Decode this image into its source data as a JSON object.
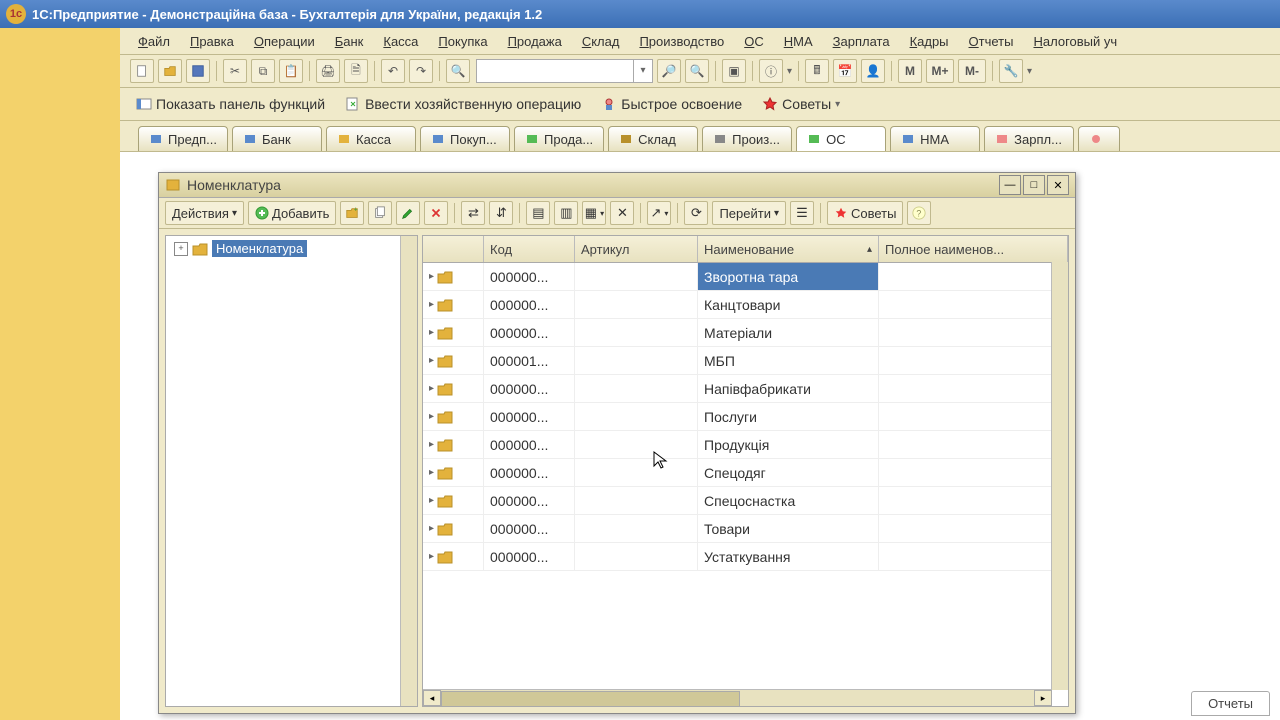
{
  "app": {
    "title": "1С:Предприятие - Демонстраційна база - Бухгалтерія для України, редакція 1.2"
  },
  "menu": [
    "Файл",
    "Правка",
    "Операции",
    "Банк",
    "Касса",
    "Покупка",
    "Продажа",
    "Склад",
    "Производство",
    "ОС",
    "НМА",
    "Зарплата",
    "Кадры",
    "Отчеты",
    "Налоговый уч"
  ],
  "funcbar": {
    "show_panel": "Показать панель функций",
    "enter_op": "Ввести хозяйственную операцию",
    "quick": "Быстрое освоение",
    "tips": "Советы"
  },
  "tabs": [
    "Предп...",
    "Банк",
    "Касса",
    "Покуп...",
    "Прода...",
    "Склад",
    "Произ...",
    "ОС",
    "НМА",
    "Зарпл..."
  ],
  "active_tab_index": 7,
  "window": {
    "title": "Номенклатура",
    "actions_label": "Действия",
    "add_label": "Добавить",
    "goto_label": "Перейти",
    "tips_label": "Советы",
    "tree_root": "Номенклатура",
    "columns": {
      "c1": "",
      "c2": "Код",
      "c3": "Артикул",
      "c4": "Наименование",
      "c5": "Полное наименов..."
    },
    "col_widths": {
      "c1": 48,
      "c2": 78,
      "c3": 110,
      "c4": 168,
      "c5": 176
    },
    "rows": [
      {
        "code": "000000...",
        "art": "",
        "name": "Зворотна тара",
        "full": ""
      },
      {
        "code": "000000...",
        "art": "",
        "name": "Канцтовари",
        "full": ""
      },
      {
        "code": "000000...",
        "art": "",
        "name": "Матеріали",
        "full": ""
      },
      {
        "code": "000001...",
        "art": "",
        "name": "МБП",
        "full": ""
      },
      {
        "code": "000000...",
        "art": "",
        "name": "Напівфабрикати",
        "full": ""
      },
      {
        "code": "000000...",
        "art": "",
        "name": "Послуги",
        "full": ""
      },
      {
        "code": "000000...",
        "art": "",
        "name": "Продукція",
        "full": ""
      },
      {
        "code": "000000...",
        "art": "",
        "name": "Спецодяг",
        "full": ""
      },
      {
        "code": "000000...",
        "art": "",
        "name": "Спецоснастка",
        "full": ""
      },
      {
        "code": "000000...",
        "art": "",
        "name": "Товари",
        "full": ""
      },
      {
        "code": "000000...",
        "art": "",
        "name": "Устаткування",
        "full": ""
      }
    ],
    "selected_row": 0
  },
  "bottom_tab": "Отчеты",
  "mbuttons": {
    "m": "M",
    "mplus": "M+",
    "mminus": "M-"
  }
}
